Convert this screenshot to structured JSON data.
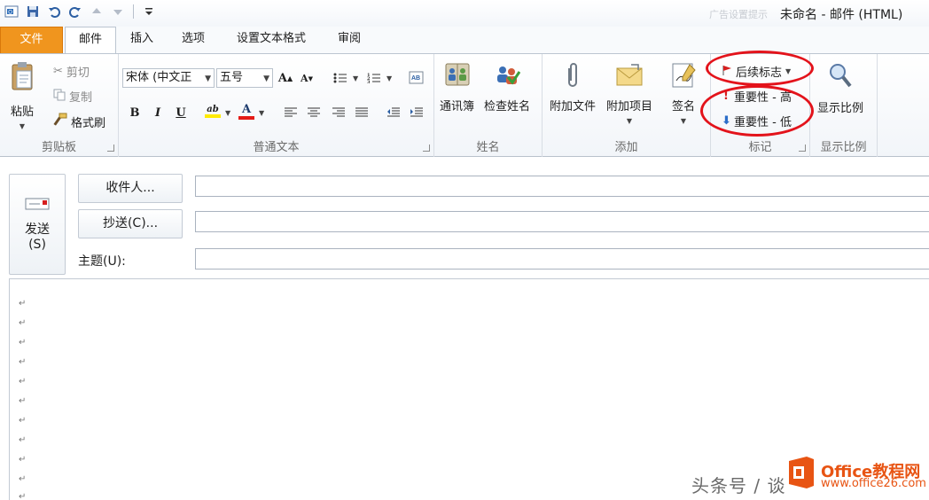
{
  "window": {
    "title": "未命名 - 邮件 (HTML)",
    "faded_title": "广告设置提示"
  },
  "tabs": [
    "文件",
    "邮件",
    "插入",
    "选项",
    "设置文本格式",
    "审阅"
  ],
  "ribbon": {
    "clipboard": {
      "label": "剪贴板",
      "paste": "粘贴",
      "cut": "剪切",
      "copy": "复制",
      "format_painter": "格式刷"
    },
    "basic_text": {
      "label": "普通文本",
      "font": "宋体 (中文正",
      "size": "五号"
    },
    "names": {
      "label": "姓名",
      "address_book": "通讯簿",
      "check_names": "检查姓名"
    },
    "include": {
      "label": "添加",
      "attach_file": "附加文件",
      "attach_item": "附加项目",
      "signature": "签名"
    },
    "tags": {
      "label": "标记",
      "follow_up": "后续标志",
      "high_importance": "重要性 - 高",
      "low_importance": "重要性 - 低"
    },
    "zoom": {
      "label": "显示比例",
      "button": "显示比例"
    }
  },
  "compose": {
    "send": "发送",
    "send_shortcut": "(S)",
    "to_button": "收件人...",
    "cc_button": "抄送(C)...",
    "subject_label": "主题(U):",
    "to_value": "",
    "cc_value": "",
    "subject_value": ""
  },
  "body": {
    "paragraph_mark": "↵"
  },
  "watermark": {
    "source": "头条号 / 谈",
    "brand": "Office教程网",
    "url": "www.office26.com"
  },
  "colors": {
    "file_tab": "#f0951e",
    "annotation_red": "#e3131b",
    "highlight_yellow": "#ffeb00",
    "font_color_red": "#e41b17",
    "watermark_orange": "#e85413"
  }
}
